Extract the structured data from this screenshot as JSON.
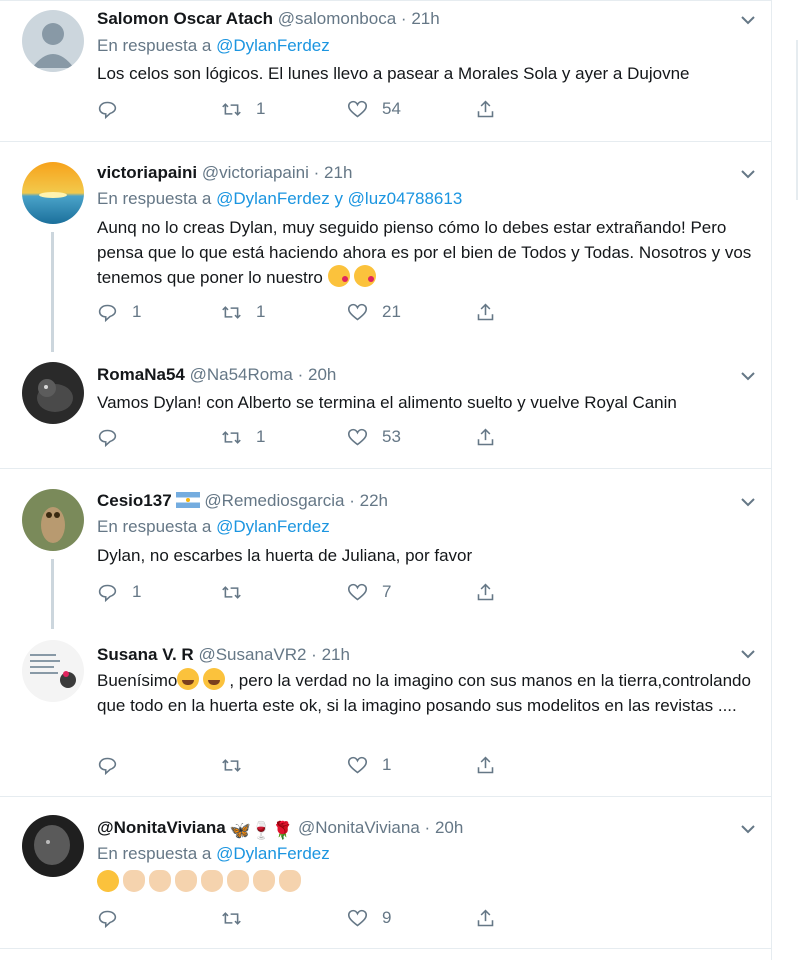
{
  "colors": {
    "link": "#1b95e0",
    "muted": "#657786",
    "text": "#14171a",
    "separator": "#e6ecf0"
  },
  "tweets": [
    {
      "name": "Salomon Oscar Atach",
      "handle": "@salomonboca",
      "dot": "·",
      "time": "21h",
      "reply_prefix": "En respuesta a",
      "reply_to": "@DylanFerdez",
      "text": "Los celos son lógicos. El lunes llevo a pasear a Morales Sola y ayer a Dujovne",
      "replies": "",
      "retweets": "1",
      "likes": "54"
    },
    {
      "name": "victoriapaini",
      "handle": "@victoriapaini",
      "dot": "·",
      "time": "21h",
      "reply_prefix": "En respuesta a",
      "reply_to": "@DylanFerdez y @luz04788613",
      "text": "Aunq no lo creas Dylan, muy seguido pienso cómo lo debes estar extrañando! Pero pensa que lo que está haciendo ahora es por el bien de Todos y Todas. Nosotros y vos tenemos que poner lo nuestro",
      "replies": "1",
      "retweets": "1",
      "likes": "21"
    },
    {
      "name": "RomaNa54",
      "handle": "@Na54Roma",
      "dot": "·",
      "time": "20h",
      "text": "Vamos Dylan! con Alberto se termina el alimento suelto y vuelve Royal Canin",
      "replies": "",
      "retweets": "1",
      "likes": "53"
    },
    {
      "name": "Cesio137",
      "handle": "@Remediosgarcia",
      "dot": "·",
      "time": "22h",
      "reply_prefix": "En respuesta a",
      "reply_to": "@DylanFerdez",
      "text": "Dylan, no  escarbes la huerta de Juliana, por favor",
      "replies": "1",
      "retweets": "",
      "likes": "7"
    },
    {
      "name": "Susana V. R",
      "handle": "@SusanaVR2",
      "dot": "·",
      "time": "21h",
      "text_start": "Buenísimo",
      "text_rest": ", pero la verdad no la imagino con sus manos en la tierra,controlando que todo en la huerta este ok, si la imagino posando sus modelitos en las revistas ....",
      "replies": "",
      "retweets": "",
      "likes": "1"
    },
    {
      "name": "@NonitaViviana",
      "name_symbols": "🦋🍷🌹",
      "handle": "@NonitaViviana",
      "dot": "·",
      "time": "20h",
      "reply_prefix": "En respuesta a",
      "reply_to": "@DylanFerdez",
      "replies": "",
      "retweets": "",
      "likes": "9"
    }
  ],
  "icons": {
    "reply": "reply-icon",
    "retweet": "retweet-icon",
    "like": "heart-icon",
    "share": "share-icon",
    "more": "chevron-down-icon",
    "flag": "argentina-flag-icon"
  }
}
